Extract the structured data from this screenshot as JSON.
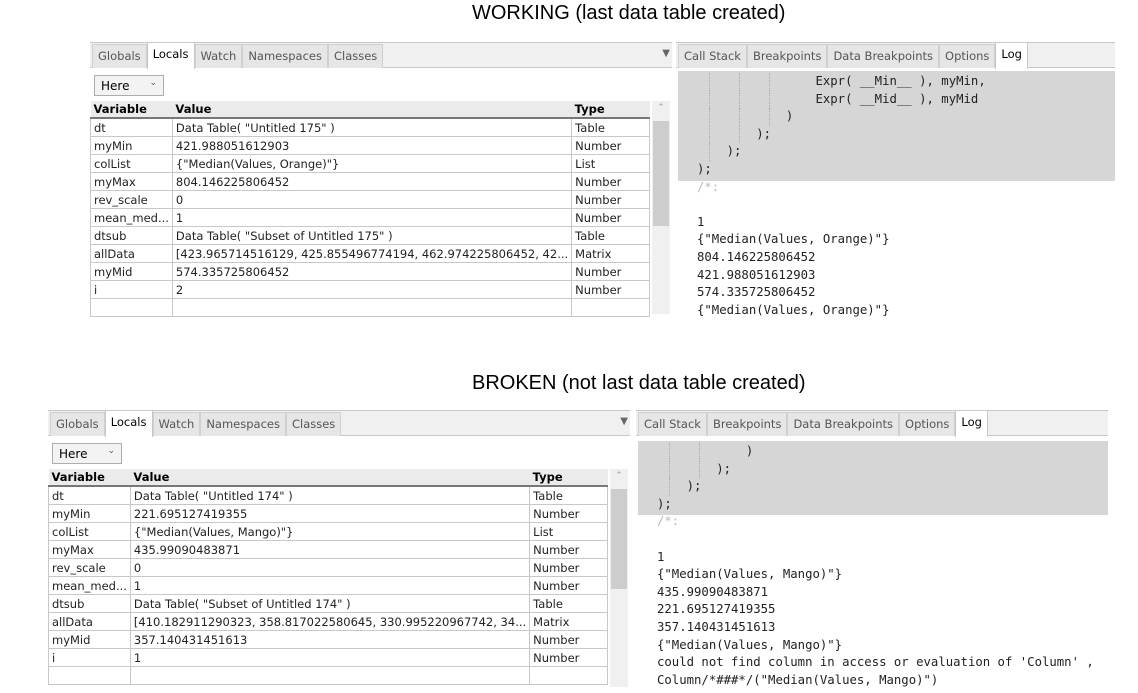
{
  "sections": [
    {
      "title": "WORKING (last data table created)",
      "left_tabs": [
        "Globals",
        "Locals",
        "Watch",
        "Namespaces",
        "Classes"
      ],
      "left_active": 1,
      "scope_dropdown": "Here",
      "columns": [
        "Variable",
        "Value",
        "Type"
      ],
      "rows": [
        [
          "dt",
          "Data Table( \"Untitled 175\" )",
          "Table"
        ],
        [
          "myMin",
          "421.988051612903",
          "Number"
        ],
        [
          "colList",
          "{\"Median(Values, Orange)\"}",
          "List"
        ],
        [
          "myMax",
          "804.146225806452",
          "Number"
        ],
        [
          "rev_scale",
          "0",
          "Number"
        ],
        [
          "mean_med...",
          "1",
          "Number"
        ],
        [
          "dtsub",
          "Data Table( \"Subset of Untitled 175\" )",
          "Table"
        ],
        [
          "allData",
          "[423.965714516129, 425.855496774194, 462.974225806452, 42...",
          "Matrix"
        ],
        [
          "myMid",
          "574.335725806452",
          "Number"
        ],
        [
          "i",
          "2",
          "Number"
        ],
        [
          "",
          "",
          ""
        ]
      ],
      "right_tabs": [
        "Call Stack",
        "Breakpoints",
        "Data Breakpoints",
        "Options",
        "Log"
      ],
      "right_active": 4,
      "code_lines": [
        "                Expr( __Min__ ), myMin,",
        "                Expr( __Mid__ ), myMid",
        "            )",
        "        );",
        "    );",
        ");"
      ],
      "log_lines": [
        "/*:",
        "",
        "1",
        "{\"Median(Values, Orange)\"}",
        "804.146225806452",
        "421.988051612903",
        "574.335725806452",
        "{\"Median(Values, Orange)\"}"
      ]
    },
    {
      "title": "BROKEN (not last data table created)",
      "left_tabs": [
        "Globals",
        "Locals",
        "Watch",
        "Namespaces",
        "Classes"
      ],
      "left_active": 1,
      "scope_dropdown": "Here",
      "columns": [
        "Variable",
        "Value",
        "Type"
      ],
      "rows": [
        [
          "dt",
          "Data Table( \"Untitled 174\" )",
          "Table"
        ],
        [
          "myMin",
          "221.695127419355",
          "Number"
        ],
        [
          "colList",
          "{\"Median(Values, Mango)\"}",
          "List"
        ],
        [
          "myMax",
          "435.99090483871",
          "Number"
        ],
        [
          "rev_scale",
          "0",
          "Number"
        ],
        [
          "mean_med...",
          "1",
          "Number"
        ],
        [
          "dtsub",
          "Data Table( \"Subset of Untitled 174\" )",
          "Table"
        ],
        [
          "allData",
          "[410.182911290323, 358.817022580645, 330.995220967742, 34...",
          "Matrix"
        ],
        [
          "myMid",
          "357.140431451613",
          "Number"
        ],
        [
          "i",
          "1",
          "Number"
        ],
        [
          "",
          "",
          ""
        ]
      ],
      "right_tabs": [
        "Call Stack",
        "Breakpoints",
        "Data Breakpoints",
        "Options",
        "Log"
      ],
      "right_active": 4,
      "code_lines": [
        "            )",
        "        );",
        "    );",
        ");"
      ],
      "log_lines": [
        "/*:",
        "",
        "1",
        "{\"Median(Values, Mango)\"}",
        "435.99090483871",
        "221.695127419355",
        "357.140431451613",
        "{\"Median(Values, Mango)\"}",
        "could not find column in access or evaluation of 'Column' ,",
        "Column/*###*/(\"Median(Values, Mango)\")"
      ]
    }
  ]
}
